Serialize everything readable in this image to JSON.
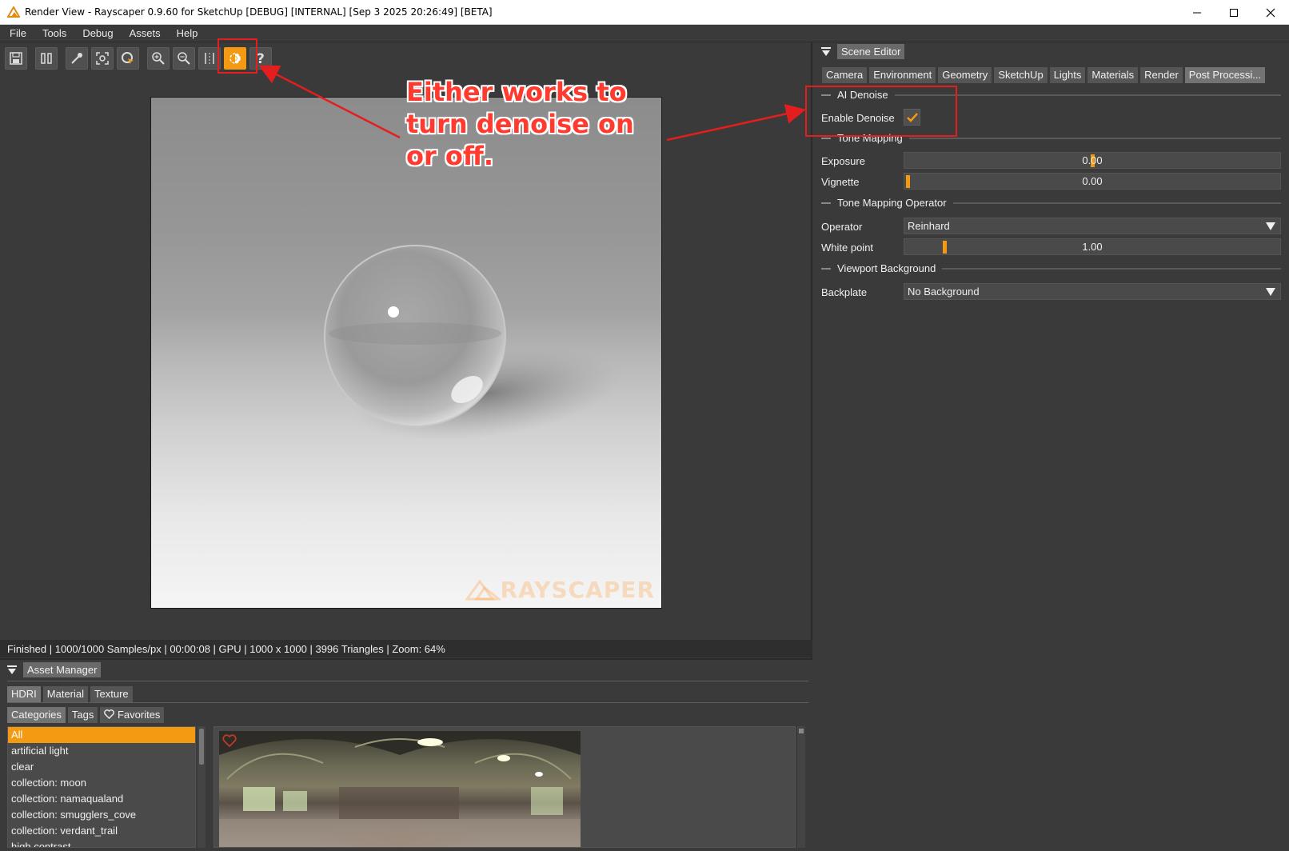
{
  "window": {
    "title": "Render View - Rayscaper 0.9.60 for SketchUp [DEBUG] [INTERNAL] [Sep  3 2025 20:26:49] [BETA]"
  },
  "menu": [
    "File",
    "Tools",
    "Debug",
    "Assets",
    "Help"
  ],
  "toolbar": {
    "buttons": [
      "save-icon",
      "pause-icon",
      "pick-icon",
      "frame-icon",
      "select-icon",
      "zoom-in-icon",
      "zoom-out-icon",
      "compare-icon",
      "denoise-icon",
      "help-icon"
    ],
    "active": "denoise-icon",
    "accent": "#f39a12"
  },
  "annotation": {
    "callout": "Either works to turn denoise on or off.",
    "color": "#ff3b30"
  },
  "render": {
    "watermark": "RAYSCAPER"
  },
  "status": "Finished | 1000/1000 Samples/px | 00:00:08 | GPU | 1000 x 1000 | 3996 Triangles | Zoom: 64%",
  "scene_editor": {
    "header": "Scene Editor",
    "tabs": [
      "Camera",
      "Environment",
      "Geometry",
      "SketchUp",
      "Lights",
      "Materials",
      "Render",
      "Post Processi..."
    ],
    "active_tab": "Post Processi...",
    "sections": {
      "ai_denoise": "AI Denoise",
      "tone_mapping": "Tone Mapping",
      "tone_mapping_operator": "Tone Mapping Operator",
      "viewport_background": "Viewport Background"
    },
    "enable_denoise": {
      "label": "Enable Denoise",
      "checked": true
    },
    "exposure": {
      "label": "Exposure",
      "value": "0.00",
      "level": 0.5
    },
    "vignette": {
      "label": "Vignette",
      "value": "0.00",
      "level": 0.0
    },
    "operator": {
      "label": "Operator",
      "value": "Reinhard"
    },
    "white_point": {
      "label": "White point",
      "value": "1.00",
      "level": 0.1
    },
    "backplate": {
      "label": "Backplate",
      "value": "No Background"
    }
  },
  "asset_manager": {
    "header": "Asset Manager",
    "type_tabs": [
      "HDRI",
      "Material",
      "Texture"
    ],
    "active_type": "HDRI",
    "view_tabs": [
      "Categories",
      "Tags",
      "Favorites"
    ],
    "active_view": "Categories",
    "categories": [
      "All",
      "artificial light",
      "clear",
      "collection: moon",
      "collection: namaqualand",
      "collection: smugglers_cove",
      "collection: verdant_trail",
      "high contrast"
    ],
    "selected_category": "All"
  }
}
